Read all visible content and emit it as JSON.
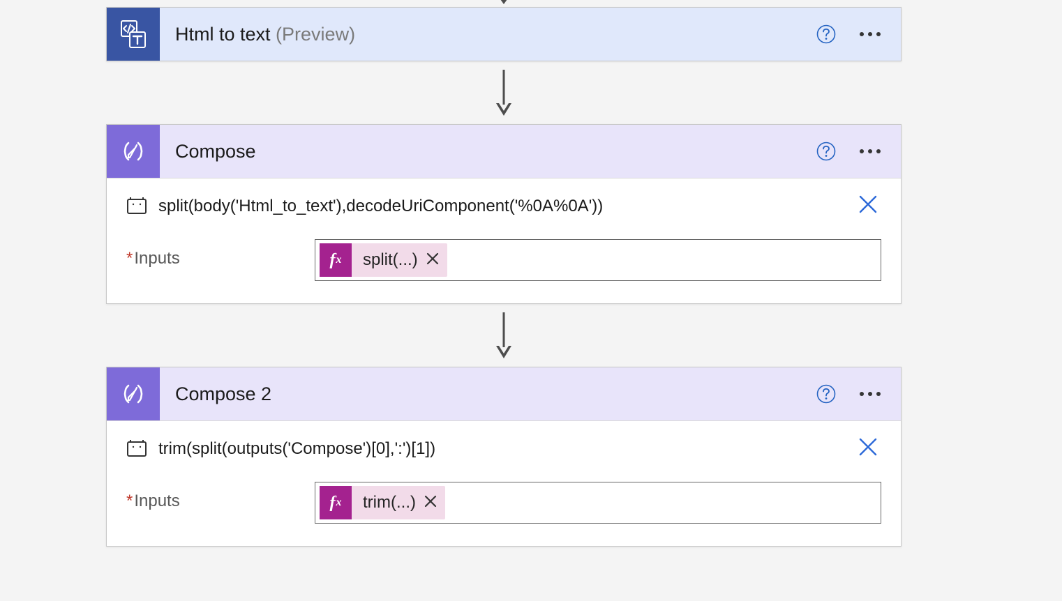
{
  "actions": [
    {
      "title": "Html to text",
      "suffix": "(Preview)",
      "type": "blue",
      "icon": "html-to-text"
    },
    {
      "title": "Compose",
      "suffix": "",
      "type": "purple",
      "icon": "compose",
      "peek": "split(body('Html_to_text'),decodeUriComponent('%0A%0A'))",
      "inputs_label": "Inputs",
      "token_label": "split(...)"
    },
    {
      "title": "Compose 2",
      "suffix": "",
      "type": "purple",
      "icon": "compose",
      "peek": "trim(split(outputs('Compose')[0],':')[1])",
      "inputs_label": "Inputs",
      "token_label": "trim(...)"
    }
  ],
  "required_marker": "*",
  "fx_label": "f",
  "fx_sub": "x"
}
